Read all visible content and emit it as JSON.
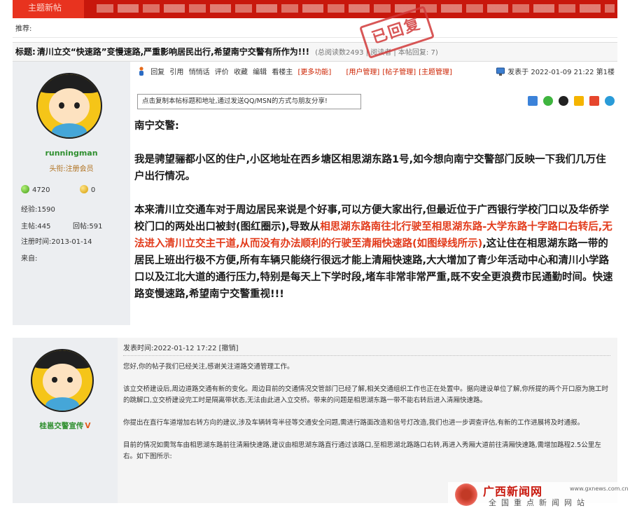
{
  "nav": {
    "active_tab": "主题新帖"
  },
  "recommend": {
    "label": "推荐:"
  },
  "thread": {
    "title_label": "标题:",
    "title": "清川立交“快速路”变慢速路,严重影响居民出行,希望南宁交警有所作为!!!",
    "stats": "(总阅读数2493 | 阅读者 | 本帖回复: 7)",
    "stamp": "已回复"
  },
  "post1": {
    "author": {
      "name": "runningman",
      "rank": "头衔:注册会员",
      "points_green": "4720",
      "points_yellow": "0",
      "exp": "经验:1590",
      "topics": "主帖:445",
      "replies": "回帖:591",
      "reg_date": "注册时间:2013-01-14",
      "from": "来自:"
    },
    "toolbar": {
      "reply": "回复",
      "quote": "引用",
      "mood": "悄悄话",
      "rate": "评价",
      "favorite": "收藏",
      "edit": "编辑",
      "owner_only": "看楼主",
      "more": "[更多功能]",
      "user_mgmt": "[用户管理]",
      "post_mgmt": "[帖子管理]",
      "topic_mgmt": "[主题管理]"
    },
    "posted": "发表于 2022-01-09 21:22 第1楼",
    "share_text": "点击复制本帖标题和地址,通过发送QQ/MSN的方式与朋友分享!",
    "body": {
      "greeting": "南宁交警:",
      "p1": "我是骋望骊都小区的住户,小区地址在西乡塘区相思湖东路1号,如今想向南宁交警部门反映一下我们几万住户出行情况。",
      "p2_a": "本来清川立交通车对于周边居民来说是个好事,可以方便大家出行,但最近位于广西银行学校门口以及华侨学校门口的两处出口被封(图红圈示),导致从",
      "p2_red": "相思湖东路南往北行驶至相思湖东路-大学东路十字路口右转后,无法进入清川立交主干道,从而没有办法顺利的行驶至清厢快速路(如图绿线所示)",
      "p2_b": ",这让住在相思湖东路一带的居民上班出行极不方便,所有车辆只能绕行很远才能上清厢快速路,大大增加了青少年活动中心和清川小学路口以及江北大道的通行压力,特别是每天上下学时段,堵车非常非常严重,既不安全更浪费市民通勤时间。快速路变慢速路,希望南宁交警重视!!!"
    }
  },
  "post2": {
    "author": {
      "name": "桂邕交警宣传",
      "badge": "V"
    },
    "posted": "发表时间:2022-01-12 17:22",
    "revoke": "[撤销]",
    "paragraphs": [
      "您好,你的帖子我们已经关注,感谢关注道路交通管理工作。",
      "该立交桥建设后,周边道路交通有新的变化。周边目前的交通情况交管部门已经了解,相关交通组织工作也正在处置中。据向建设单位了解,你所提的两个开口原为施工时的跳解口,立交桥建设完工时是隔离带状态,无法由此进入立交桥。带来的问题是相思湖东路一带不能右转后进入清厢快速路。",
      "你提出在直行车道增加右转方向的建议,涉及车辆转弯半径等交通安全问题,需进行路面改造和信号灯改造,我们也进一步调查评估,有新的工作进展将及时通报。",
      "目前的情况如需驾车由相思湖东路前往清厢快速路,建议由相思湖东路直行通过该路口,至相思湖北路路口右转,再进入秀厢大道前往清厢快速路,需增加路程2.5公里左右。如下图所示:"
    ]
  },
  "watermark": {
    "title": "广西新闻网",
    "domain": "www.gxnews.com.cn",
    "slogan": "全国重点新闻网站"
  },
  "colors": {
    "brand_red": "#c8170c",
    "highlight_red": "#e23a1a",
    "user_green": "#2f8f2f"
  }
}
